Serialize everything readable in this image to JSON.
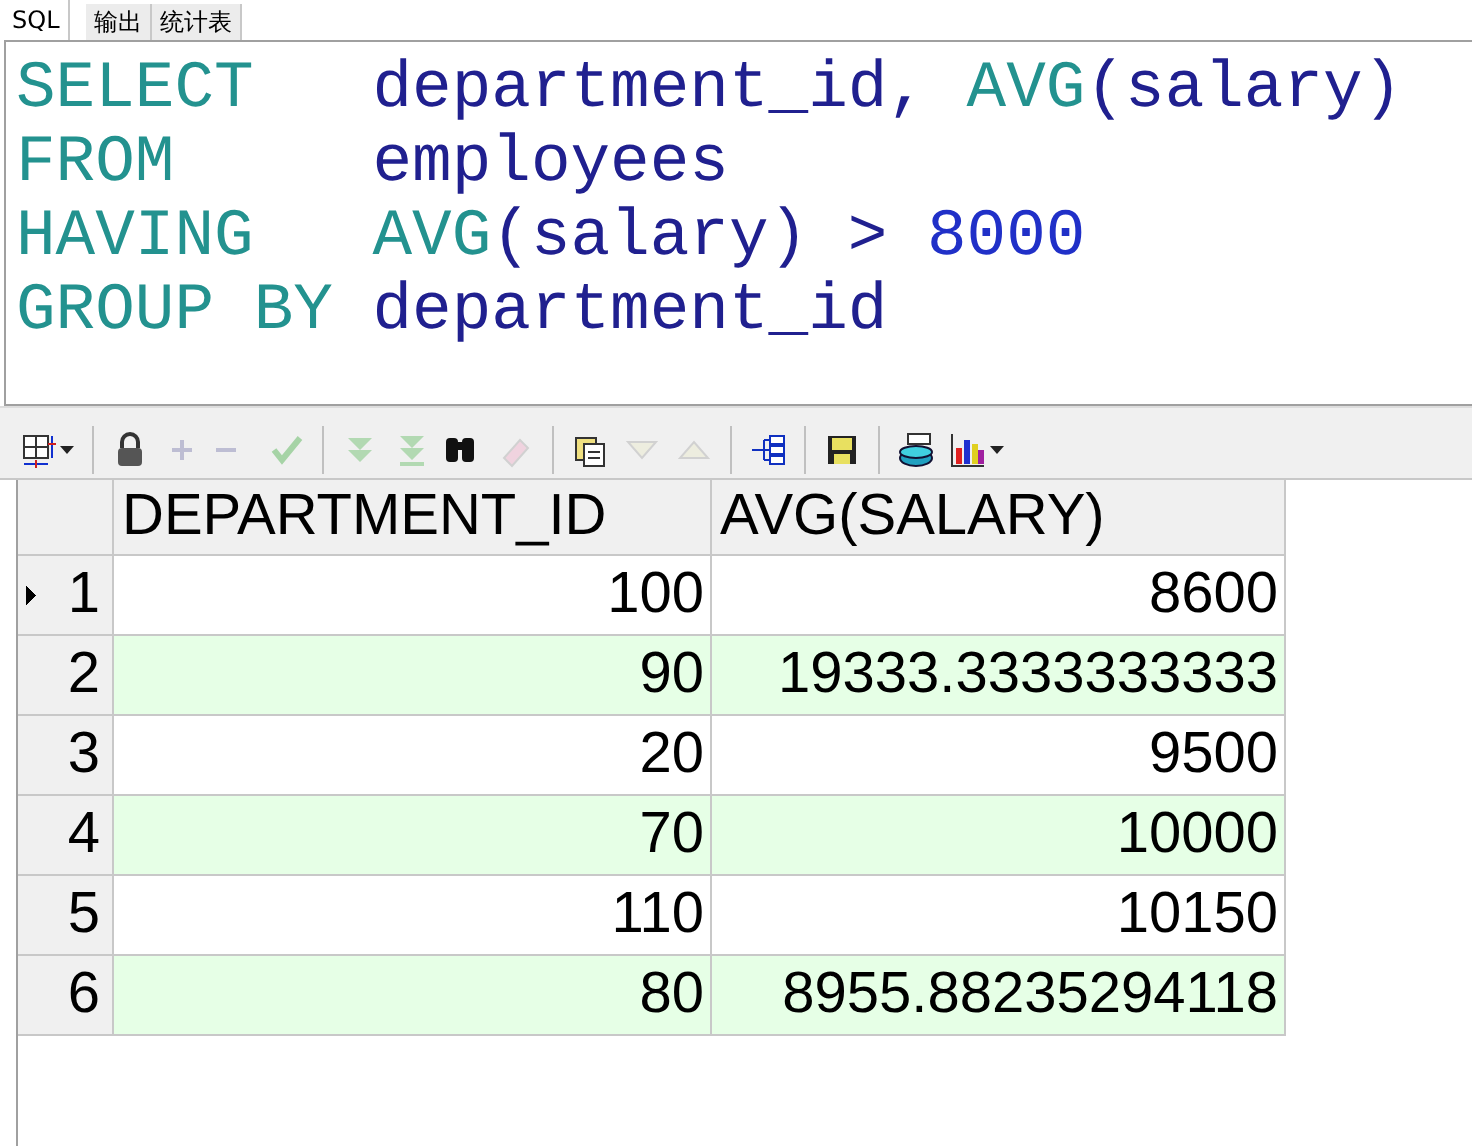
{
  "tabs": [
    {
      "label": "SQL",
      "selected": true
    },
    {
      "label": "输出",
      "selected": false
    },
    {
      "label": "统计表",
      "selected": false
    }
  ],
  "editor": {
    "lines": [
      [
        {
          "kind": "keyword",
          "text": "SELECT   "
        },
        {
          "kind": "ident",
          "text": "department_id, "
        },
        {
          "kind": "keyword",
          "text": "AVG"
        },
        {
          "kind": "ident",
          "text": "(salary)"
        }
      ],
      [
        {
          "kind": "keyword",
          "text": "FROM     "
        },
        {
          "kind": "ident",
          "text": "employees"
        }
      ],
      [
        {
          "kind": "keyword",
          "text": "HAVING   "
        },
        {
          "kind": "keyword",
          "text": "AVG"
        },
        {
          "kind": "ident",
          "text": "(salary) > "
        },
        {
          "kind": "number",
          "text": "8000"
        }
      ],
      [
        {
          "kind": "keyword",
          "text": "GROUP BY "
        },
        {
          "kind": "ident",
          "text": "department_id"
        }
      ]
    ]
  },
  "toolbar": [
    {
      "kind": "grid",
      "disabled": false,
      "caret": true
    },
    {
      "kind": "sep"
    },
    {
      "kind": "lock",
      "disabled": false
    },
    {
      "kind": "plus",
      "disabled": true
    },
    {
      "kind": "minus",
      "disabled": true
    },
    {
      "kind": "check",
      "disabled": true
    },
    {
      "kind": "sep"
    },
    {
      "kind": "next",
      "disabled": true
    },
    {
      "kind": "last",
      "disabled": true
    },
    {
      "kind": "binoculars",
      "disabled": false
    },
    {
      "kind": "eraser",
      "disabled": true
    },
    {
      "kind": "sep"
    },
    {
      "kind": "pages",
      "disabled": false
    },
    {
      "kind": "down",
      "disabled": true
    },
    {
      "kind": "up",
      "disabled": true
    },
    {
      "kind": "sep"
    },
    {
      "kind": "tree",
      "disabled": false
    },
    {
      "kind": "sep"
    },
    {
      "kind": "save",
      "disabled": false
    },
    {
      "kind": "sep"
    },
    {
      "kind": "database",
      "disabled": false
    },
    {
      "kind": "chart",
      "disabled": false,
      "caret": true
    }
  ],
  "table": {
    "columns": [
      "DEPARTMENT_ID",
      "AVG(SALARY)"
    ],
    "rows": [
      {
        "number": "1",
        "selected": true,
        "cells": [
          "100",
          "8600"
        ]
      },
      {
        "number": "2",
        "selected": false,
        "cells": [
          "90",
          "19333.3333333333"
        ]
      },
      {
        "number": "3",
        "selected": false,
        "cells": [
          "20",
          "9500"
        ]
      },
      {
        "number": "4",
        "selected": false,
        "cells": [
          "70",
          "10000"
        ]
      },
      {
        "number": "5",
        "selected": false,
        "cells": [
          "110",
          "10150"
        ]
      },
      {
        "number": "6",
        "selected": false,
        "cells": [
          "80",
          "8955.88235294118"
        ]
      }
    ]
  }
}
